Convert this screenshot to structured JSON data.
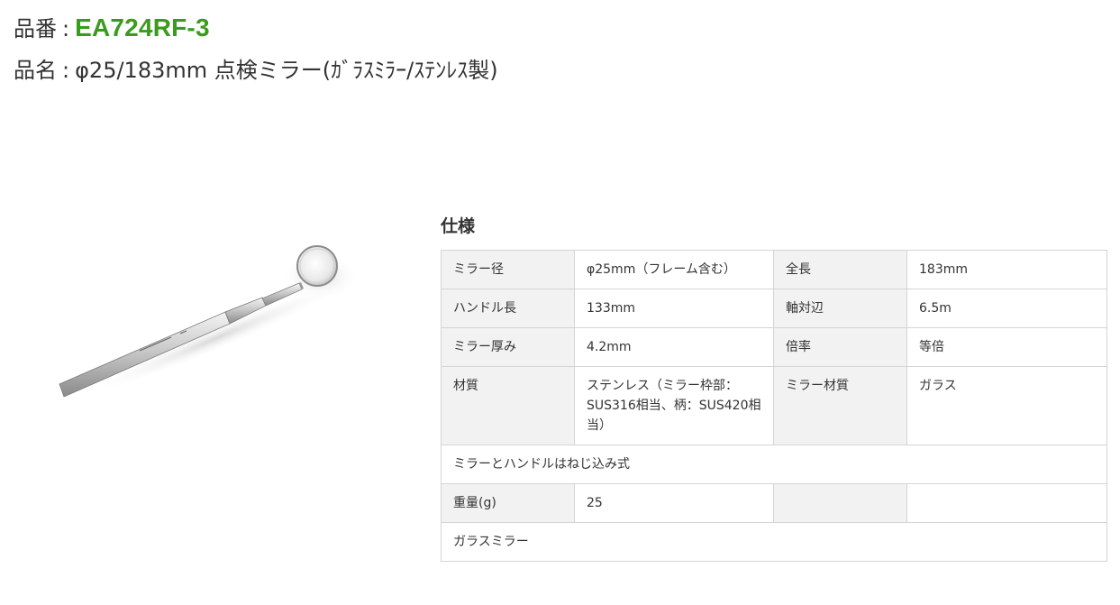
{
  "header": {
    "item_code_label": "品番",
    "separator": ":",
    "item_code": "EA724RF-3",
    "item_name_label": "品名",
    "item_name": "φ25/183mm 点検ミラー(ｶﾞﾗｽﾐﾗｰ/ｽﾃﾝﾚｽ製)"
  },
  "product_image": {
    "alt": "inspection-mirror"
  },
  "spec": {
    "title": "仕様",
    "rows": [
      {
        "l1": "ミラー径",
        "v1": "φ25mm（フレーム含む）",
        "l2": "全長",
        "v2": "183mm"
      },
      {
        "l1": "ハンドル長",
        "v1": "133mm",
        "l2": "軸対辺",
        "v2": "6.5m"
      },
      {
        "l1": "ミラー厚み",
        "v1": "4.2mm",
        "l2": "倍率",
        "v2": "等倍"
      },
      {
        "l1": "材質",
        "v1": "ステンレス（ミラー枠部：SUS316相当、柄：SUS420相当）",
        "l2": "ミラー材質",
        "v2": "ガラス"
      }
    ],
    "note1": "ミラーとハンドルはねじ込み式",
    "weight_label": "重量(g)",
    "weight_value": "25",
    "weight_l2": "",
    "weight_v2": "",
    "note2": "ガラスミラー"
  }
}
